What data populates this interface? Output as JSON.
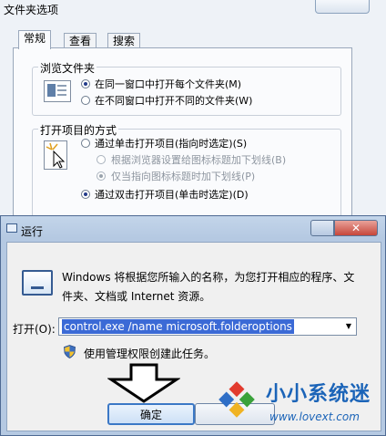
{
  "folder_options": {
    "title": "文件夹选项",
    "tabs": [
      "常规",
      "查看",
      "搜索"
    ],
    "browse": {
      "title": "浏览文件夹",
      "options": [
        {
          "label": "在同一窗口中打开每个文件夹(M)",
          "selected": true
        },
        {
          "label": "在不同窗口中打开不同的文件夹(W)",
          "selected": false
        }
      ]
    },
    "open_items": {
      "title": "打开项目的方式",
      "options": [
        {
          "label": "通过单击打开项目(指向时选定)(S)",
          "selected": false
        },
        {
          "label": "根据浏览器设置给图标标题加下划线(B)",
          "selected": false,
          "disabled": true
        },
        {
          "label": "仅当指向图标标题时加下划线(P)",
          "selected": true,
          "disabled": true
        },
        {
          "label": "通过双击打开项目(单击时选定)(D)",
          "selected": true
        }
      ]
    }
  },
  "run": {
    "title": "运行",
    "description": "Windows 将根据您所输入的名称，为您打开相应的程序、文件夹、文档或 Internet 资源。",
    "open_label": "打开(O):",
    "command": "control.exe /name microsoft.folderoptions",
    "admin_note": "使用管理权限创建此任务。",
    "ok_label": "确定"
  },
  "watermark": {
    "text": "小小系统迷",
    "url": "www.lovext.com"
  },
  "colors": {
    "accent": "#3b6ad6",
    "watermark": "#1b64b8"
  }
}
